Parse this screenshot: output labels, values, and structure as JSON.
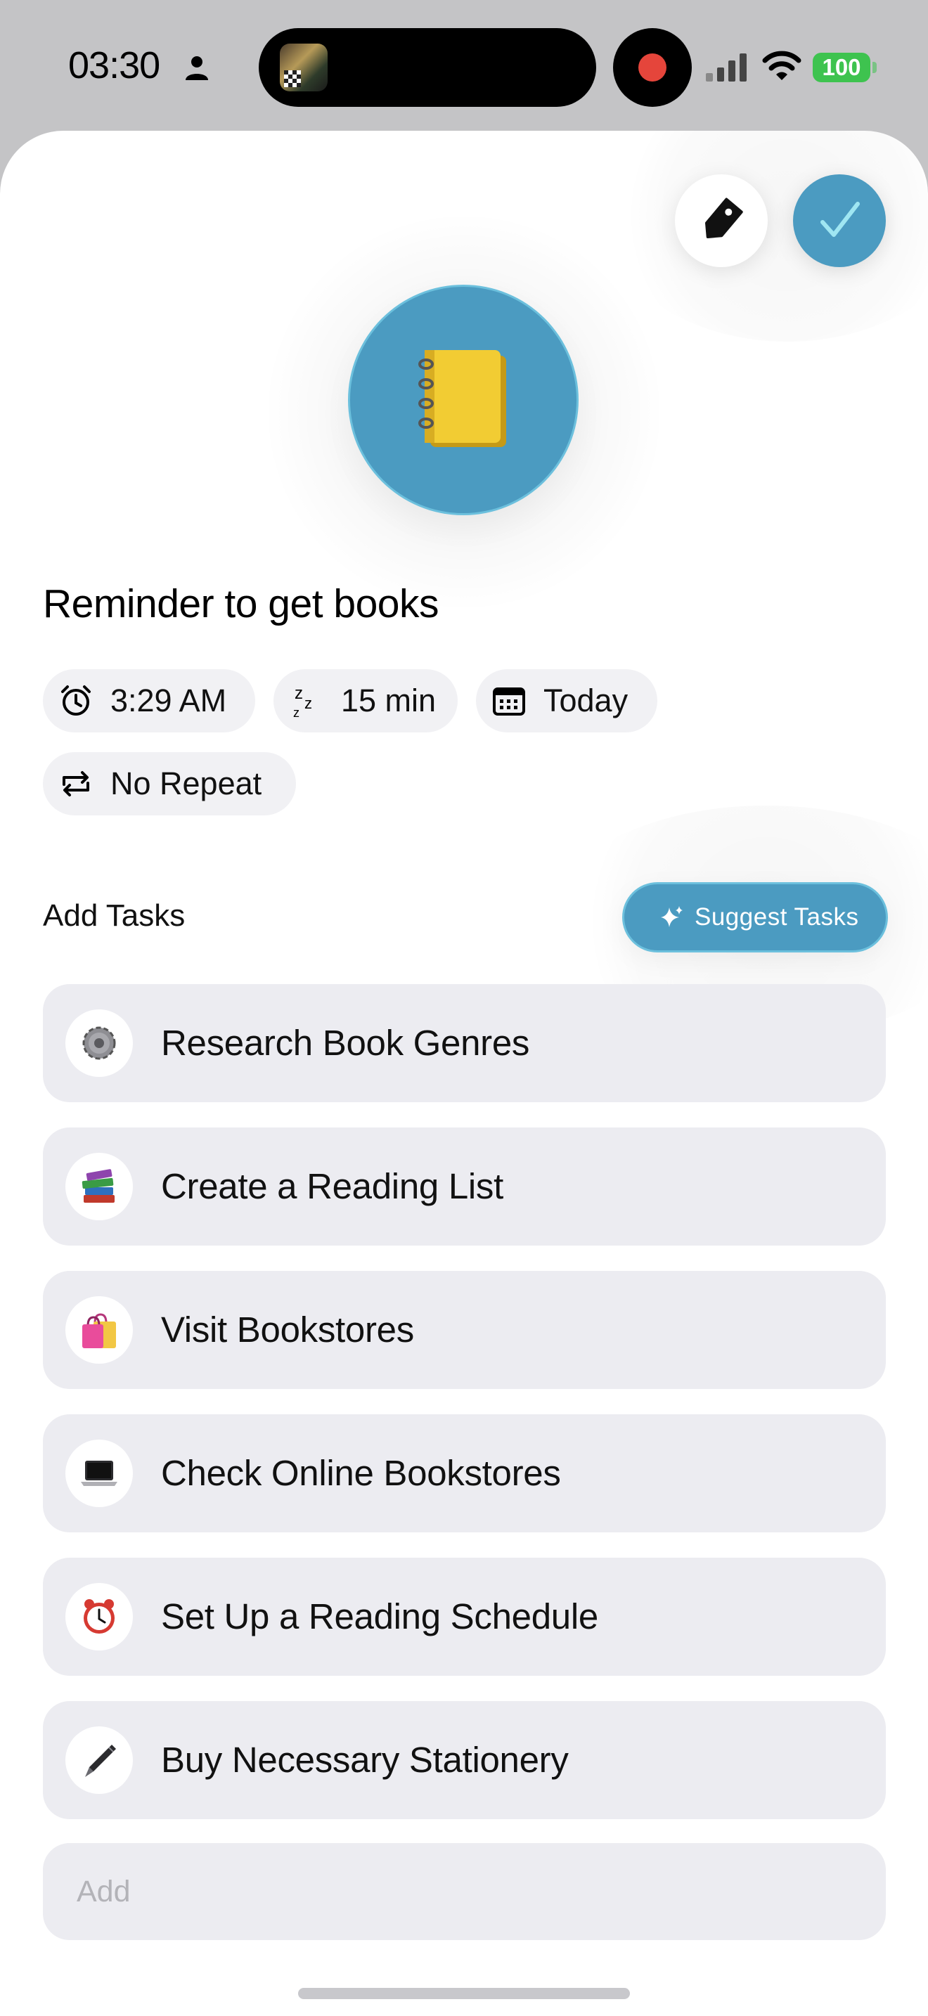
{
  "status_bar": {
    "time": "03:30",
    "battery": "100",
    "icons": [
      "person-icon",
      "signal-icon",
      "wifi-icon",
      "battery-icon",
      "recording-icon"
    ]
  },
  "header": {
    "icons": [
      "tag-icon",
      "checkmark-icon"
    ],
    "accent_color": "#4b9bc1"
  },
  "reminder": {
    "emoji_icon": "notebook-icon",
    "title": "Reminder to get books",
    "chips": {
      "time": "3:29 AM",
      "snooze": "15 min",
      "date": "Today",
      "repeat": "No Repeat"
    }
  },
  "tasks_section": {
    "label": "Add Tasks",
    "suggest_button": "Suggest Tasks",
    "items": [
      {
        "label": "Research Book Genres",
        "icon": "gear-icon"
      },
      {
        "label": "Create a Reading List",
        "icon": "books-icon"
      },
      {
        "label": "Visit Bookstores",
        "icon": "shopping-bags-icon"
      },
      {
        "label": "Check Online Bookstores",
        "icon": "laptop-icon"
      },
      {
        "label": "Set Up a Reading Schedule",
        "icon": "alarm-clock-icon"
      },
      {
        "label": "Buy Necessary Stationery",
        "icon": "pen-icon"
      }
    ],
    "add_placeholder": "Add"
  }
}
